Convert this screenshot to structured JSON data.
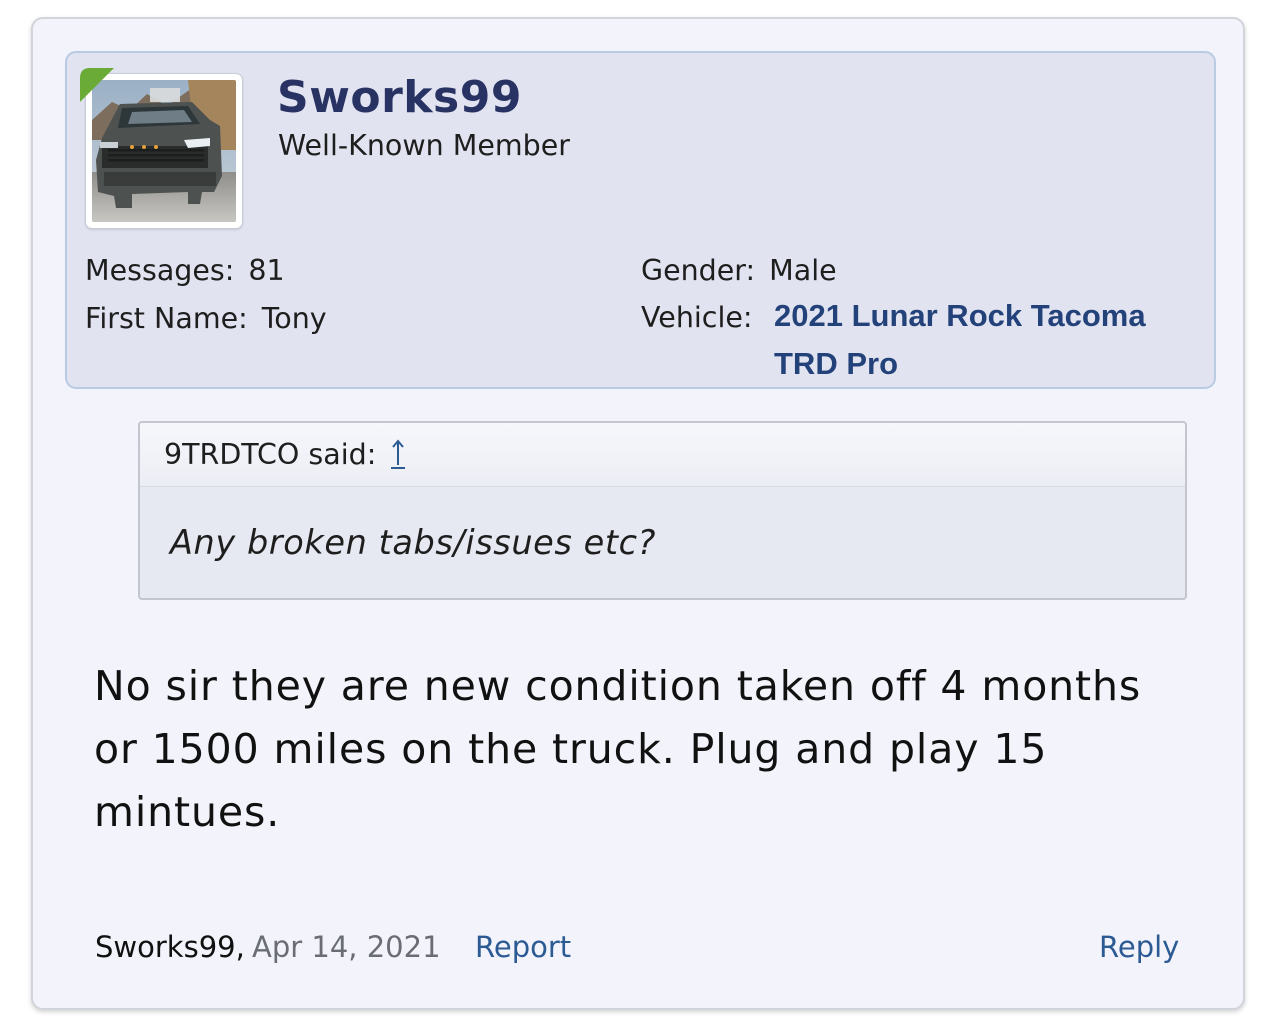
{
  "user": {
    "username": "Sworks99",
    "title": "Well-Known Member",
    "avatar_icon": "avatar-photo-truck",
    "online_badge_color": "#6aab38"
  },
  "stats": {
    "messages_label": "Messages:",
    "messages_value": "81",
    "first_name_label": "First Name:",
    "first_name_value": "Tony",
    "gender_label": "Gender:",
    "gender_value": "Male",
    "vehicle_label": "Vehicle:",
    "vehicle_value": "2021 Lunar Rock Tacoma TRD Pro"
  },
  "quote": {
    "author_text": "9TRDTCO said:",
    "jump_icon": "arrow-up-icon",
    "body": "Any broken tabs/issues etc?"
  },
  "post": {
    "body": "No sir they are new condition taken off 4 months or 1500 miles on the truck. Plug and play 15 mintues."
  },
  "footer": {
    "author": "Sworks99,",
    "date": "Apr 14, 2021",
    "report_label": "Report",
    "reply_label": "Reply"
  },
  "colors": {
    "card_bg": "#f3f4fb",
    "user_panel_bg": "#e1e4f0",
    "username": "#283263",
    "link": "#2c5a93",
    "vehicle": "#24427a"
  }
}
